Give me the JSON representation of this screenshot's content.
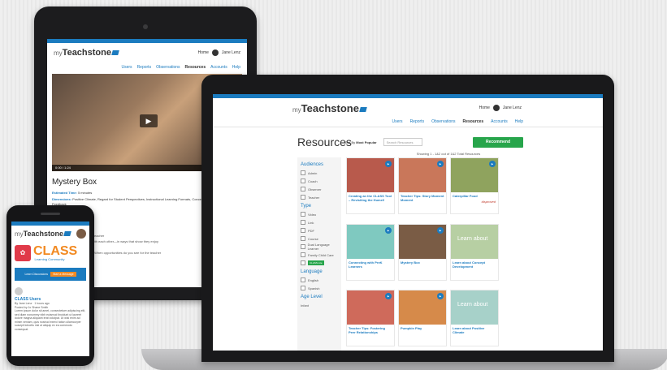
{
  "tablet": {
    "logo_prefix": "my",
    "logo_main": "Teachstone",
    "header_links": [
      "Home",
      "Jane Lenz"
    ],
    "nav": [
      "Users",
      "Reports",
      "Observations",
      "Resources",
      "Accounts",
      "Help"
    ],
    "video_controls": "0:00 / 1:24",
    "title": "Mystery Box",
    "meta": [
      {
        "label": "Estimated Time:",
        "value": "5 minutes"
      },
      {
        "label": "Dimensions:",
        "value": "Positive Climate, Regard for Student Perspectives, Instructional Learning Formats, Concept Development, Quality of Feedback"
      },
      {
        "label": "Age Levels:",
        "value": "PreK"
      },
      {
        "label": "Audiences:",
        "value": "Teacher"
      }
    ],
    "look_for": "Look For",
    "lines": [
      "...anization, look for how the teacher",
      "...and how children interact with each other—in ways that show they enjoy",
      "...literacy activity",
      "...ort with children effectively. When opportunities do you see for the teacher"
    ]
  },
  "laptop": {
    "logo_prefix": "my",
    "logo_main": "Teachstone",
    "header_links": [
      "Home",
      "Jane Lenz"
    ],
    "nav": [
      "Users",
      "Reports",
      "Observations",
      "Resources",
      "Accounts",
      "Help"
    ],
    "page_title": "Resources",
    "sort_label": "Sort By",
    "sort_value": "Most Popular",
    "search_placeholder": "Search Resources",
    "recommend_label": "Recommend",
    "showing": "Showing 1 - 1&2 out of 1&2 Total Resources",
    "sidebar": {
      "audiences_title": "Audiences",
      "audiences": [
        "Admin",
        "Coach",
        "Observer",
        "Teacher"
      ],
      "type_title": "Type",
      "types": [
        "Video",
        "Link",
        "PDF",
        "Course"
      ],
      "extras": [
        "Dual Language Learner",
        "Family Child Care"
      ],
      "tag": "CLASS Lite",
      "language_title": "Language",
      "languages": [
        "English",
        "Spanish"
      ],
      "age_title": "Age Level",
      "age_first": "Infant"
    },
    "cards": [
      {
        "title": "Creating an the CLASS Tool – Revisiting the Humel!",
        "thumb": "#b85a4c",
        "flag": ""
      },
      {
        "title": "Teacher Tips: Story Moment Moment",
        "thumb": "#c9775a",
        "flag": ""
      },
      {
        "title": "Caterpillar Food",
        "thumb": "#8fa35e",
        "flag": "disproved"
      },
      {
        "title": "Connecting with PreK Learners",
        "thumb": "#7fc9c0",
        "flag": ""
      },
      {
        "title": "Mystery Box",
        "thumb": "#7a5c45",
        "flag": ""
      },
      {
        "title": "Learn about Concept Development",
        "thumb": "#b7cfa3",
        "flag": ""
      },
      {
        "title": "Teacher Tips: Fostering Peer Relationships",
        "thumb": "#cf6a5b",
        "flag": ""
      },
      {
        "title": "Pumpkin Play",
        "thumb": "#d68a4a",
        "flag": ""
      },
      {
        "title": "Learn about Positive Climate",
        "thumb": "#a7d1c9",
        "flag": ""
      }
    ],
    "learn_text": "Learn about"
  },
  "phone": {
    "logo_prefix": "my",
    "logo_main": "Teachstone",
    "class_word": "CLASS",
    "class_sub": "Learning Community",
    "btn_text": "Learn Discussions",
    "btn_action": "Start a Message",
    "item_title": "CLASS Users",
    "item_meta": "By Jane Lenz · 1 hours ago",
    "item_sub": "Posted by  Jo Shane Smith",
    "body": "Lorem ipsum dolor sit amet, consectetuer adipiscing elit, sed diam nonummy nibh euismod tincidunt ut laoreet dolore magna aliquam erat volutpat. Ut wisi enim ad minim veniam, quis nostrud exerci tation ullamcorper suscipit lobortis nisl ut aliquip ex ea commodo consequat."
  },
  "colors": {
    "brand_blue": "#1b7bbf",
    "accent_green": "#27a54b",
    "class_orange": "#f28a22",
    "class_red": "#e03a49"
  }
}
